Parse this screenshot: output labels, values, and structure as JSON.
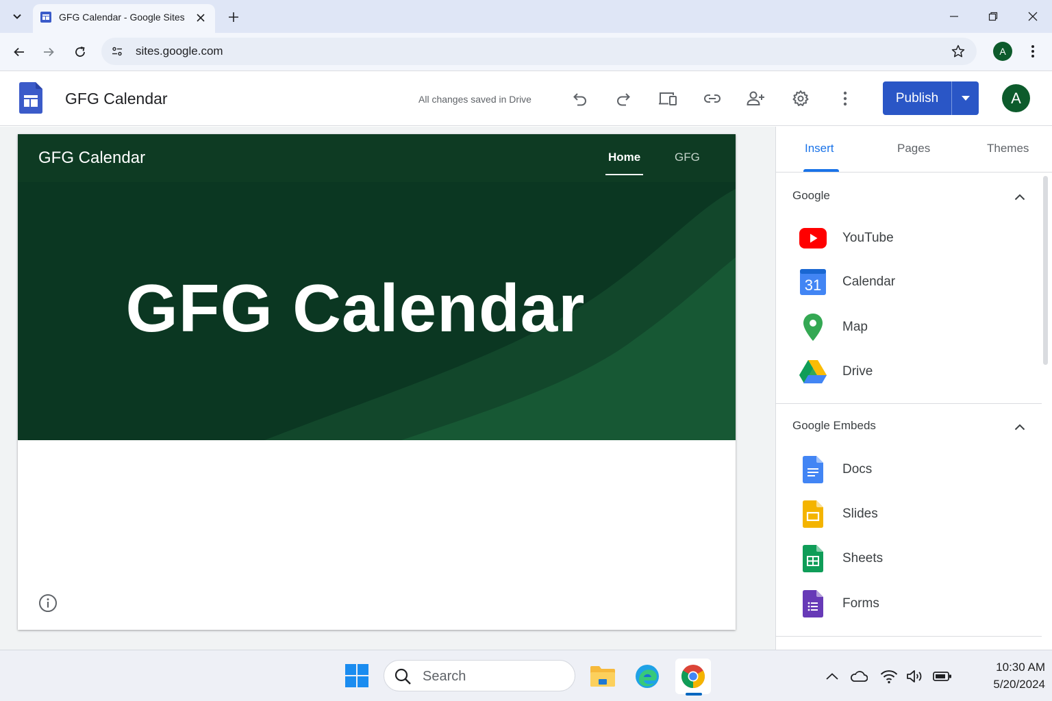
{
  "browser": {
    "tab_title": "GFG Calendar - Google Sites",
    "url": "sites.google.com",
    "profile_initial": "A"
  },
  "sites_header": {
    "site_title": "GFG Calendar",
    "save_status": "All changes saved in Drive",
    "publish_label": "Publish",
    "account_initial": "A"
  },
  "page": {
    "site_name": "GFG Calendar",
    "nav": [
      {
        "label": "Home",
        "active": true
      },
      {
        "label": "GFG",
        "active": false
      }
    ],
    "hero_title": "GFG Calendar"
  },
  "panel": {
    "tabs": [
      {
        "label": "Insert",
        "active": true
      },
      {
        "label": "Pages",
        "active": false
      },
      {
        "label": "Themes",
        "active": false
      }
    ],
    "google_section": {
      "title": "Google",
      "items": [
        {
          "label": "YouTube",
          "icon": "youtube-icon"
        },
        {
          "label": "Calendar",
          "icon": "calendar-icon",
          "icon_text": "31"
        },
        {
          "label": "Map",
          "icon": "map-pin-icon"
        },
        {
          "label": "Drive",
          "icon": "drive-icon"
        }
      ]
    },
    "embeds_section": {
      "title": "Google Embeds",
      "items": [
        {
          "label": "Docs",
          "icon": "docs-icon"
        },
        {
          "label": "Slides",
          "icon": "slides-icon"
        },
        {
          "label": "Sheets",
          "icon": "sheets-icon"
        },
        {
          "label": "Forms",
          "icon": "forms-icon"
        }
      ]
    }
  },
  "taskbar": {
    "search_label": "Search",
    "time": "10:30 AM",
    "date": "5/20/2024"
  },
  "colors": {
    "publish_blue": "#2a56c6",
    "site_green": "#0e3b23",
    "accent_blue": "#1a73e8"
  }
}
